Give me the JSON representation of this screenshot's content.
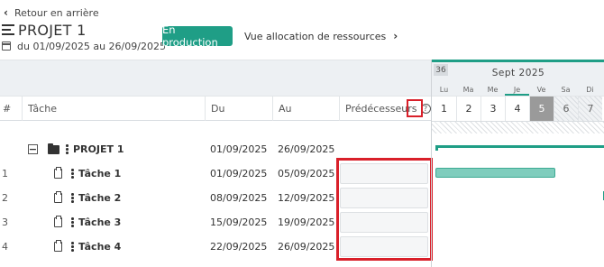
{
  "header": {
    "back_label": "Retour en arrière",
    "project_title": "PROJET 1",
    "date_range": "du 01/09/2025 au 26/09/2025",
    "status_badge": "En production",
    "resource_link": "Vue allocation de ressources",
    "accent_color": "#1f9e86"
  },
  "table": {
    "columns": {
      "num": "#",
      "task": "Tâche",
      "from": "Du",
      "to": "Au",
      "predecessors": "Prédécesseurs"
    },
    "help_icon": "question-circle-icon",
    "rows": [
      {
        "num": "",
        "name": "PROJET 1",
        "from": "01/09/2025",
        "to": "26/09/2025",
        "type": "project"
      },
      {
        "num": "1",
        "name": "Tâche 1",
        "from": "01/09/2025",
        "to": "05/09/2025",
        "type": "task"
      },
      {
        "num": "2",
        "name": "Tâche 2",
        "from": "08/09/2025",
        "to": "12/09/2025",
        "type": "task"
      },
      {
        "num": "3",
        "name": "Tâche 3",
        "from": "15/09/2025",
        "to": "19/09/2025",
        "type": "task"
      },
      {
        "num": "4",
        "name": "Tâche 4",
        "from": "22/09/2025",
        "to": "26/09/2025",
        "type": "task"
      }
    ]
  },
  "gantt": {
    "week_number": "36",
    "month": "Sept  2025",
    "day_names": [
      "Lu",
      "Ma",
      "Me",
      "Je",
      "Ve",
      "Sa",
      "Di"
    ],
    "day_numbers": [
      "1",
      "2",
      "3",
      "4",
      "5",
      "6",
      "7"
    ],
    "today_day": "Je",
    "selected_day": "5"
  }
}
